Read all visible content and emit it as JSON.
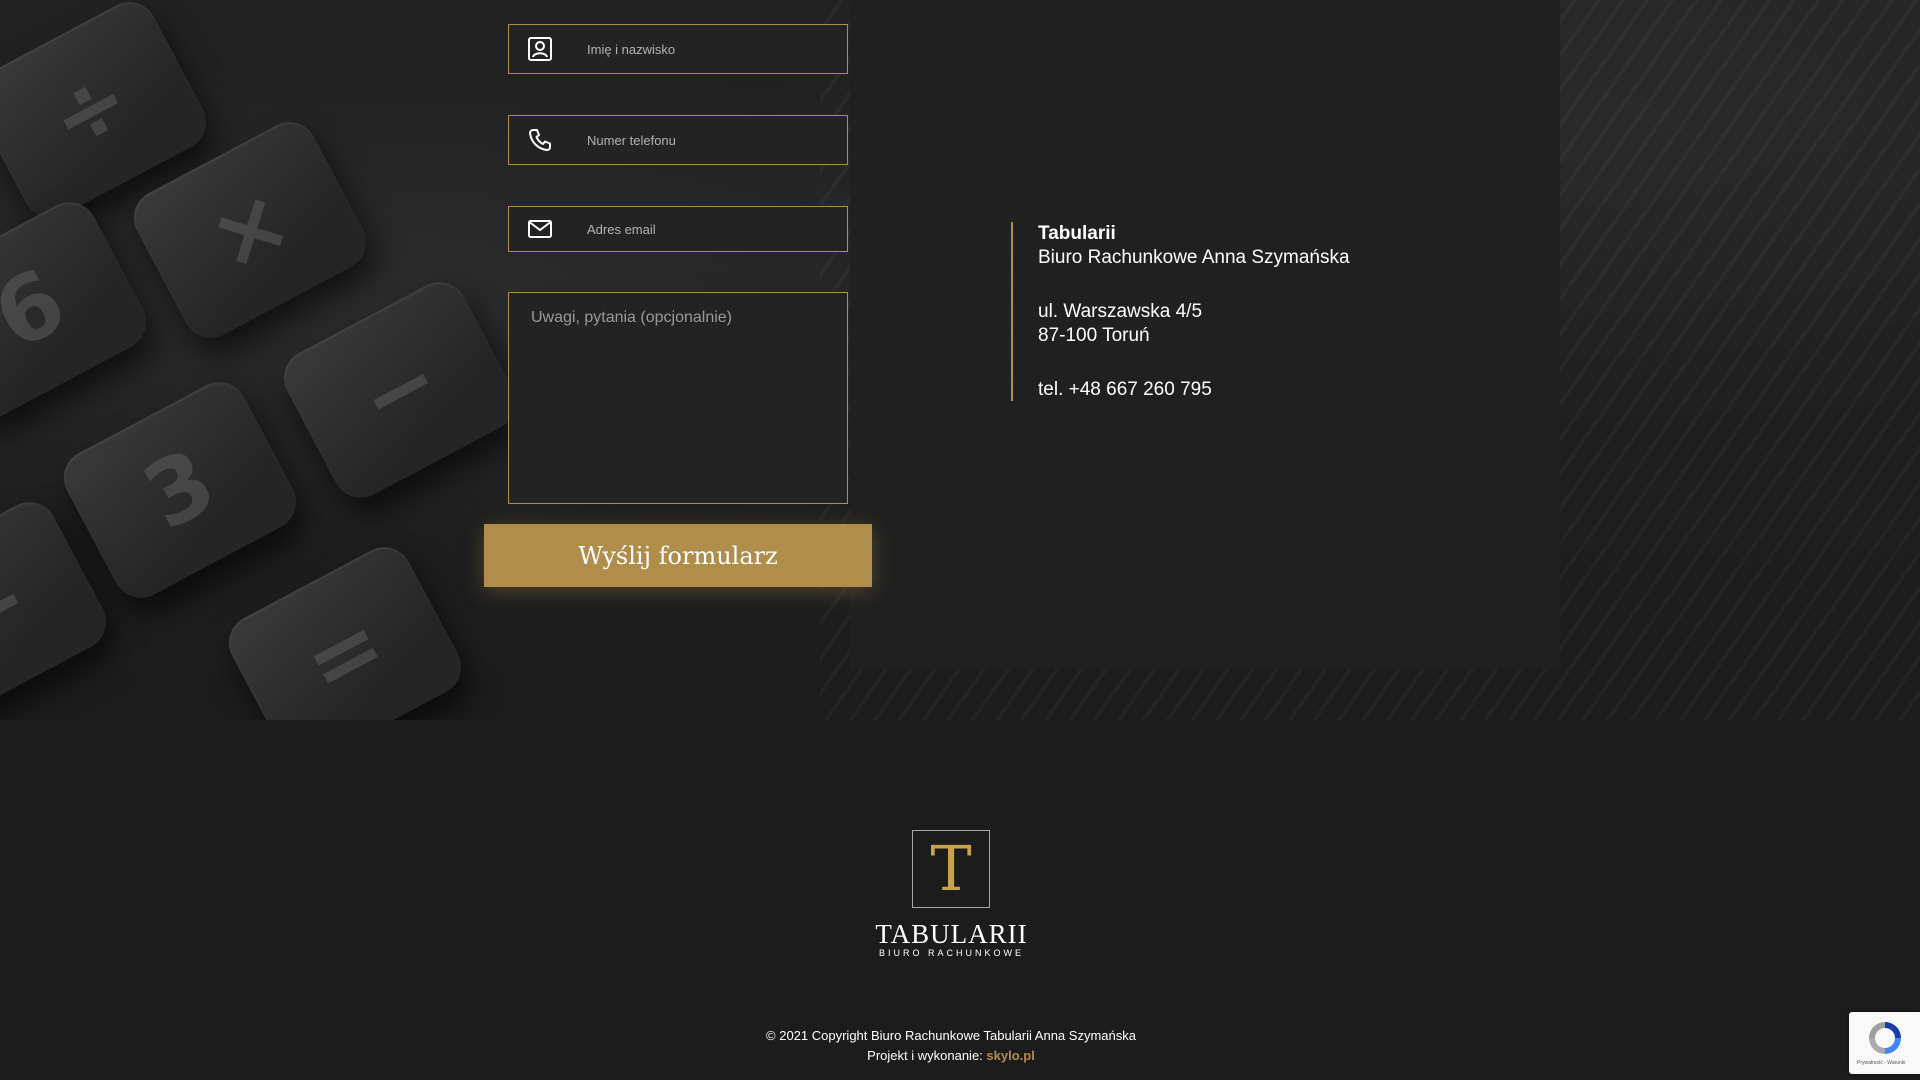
{
  "form": {
    "name_placeholder": "Imię i nazwisko",
    "phone_placeholder": "Numer telefonu",
    "email_placeholder": "Adres email",
    "message_placeholder": "Uwagi, pytania (opcjonalnie)",
    "submit_label": "Wyślij formularz"
  },
  "contact": {
    "company_name": "Tabularii",
    "company_full": "Biuro Rachunkowe Anna Szymańska",
    "street": "ul. Warszawska 4/5",
    "city": "87-100 Toruń",
    "phone": "tel. +48 667 260 795"
  },
  "footer": {
    "logo_letter": "T",
    "logo_name": "TABULARII",
    "logo_tagline": "BIURO RACHUNKOWE",
    "copyright": "© 2021 Copyright Biuro Rachunkowe Tabularii Anna Szymańska",
    "credit_prefix": "Projekt i wykonanie: ",
    "credit_link": "skylo.pl"
  },
  "recaptcha": {
    "footer_text": "Prywatność - Warunki"
  },
  "colors": {
    "accent": "#b08d4a",
    "background": "#1c1c1c",
    "text": "#ffffff"
  },
  "icons": {
    "name_field": "user-icon",
    "phone_field": "phone-icon",
    "email_field": "mail-icon",
    "recaptcha": "recaptcha-icon"
  }
}
